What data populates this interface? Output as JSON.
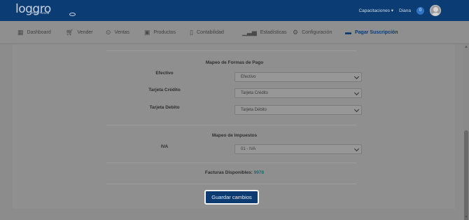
{
  "header": {
    "logo_text": "loggro",
    "logo_sub": "POS Tienda",
    "capacitaciones": "Capacitaciones",
    "user_name": "Diana",
    "badge": "0"
  },
  "nav": {
    "items": [
      {
        "label": "Dashboard",
        "icon": "dashboard-icon"
      },
      {
        "label": "Vender",
        "icon": "cart-icon"
      },
      {
        "label": "Ventas",
        "icon": "money-icon"
      },
      {
        "label": "Productos",
        "icon": "box-icon"
      },
      {
        "label": "Contabilidad",
        "icon": "book-icon"
      },
      {
        "label": "Estadísticas",
        "icon": "bar-chart-icon"
      },
      {
        "label": "Configuración",
        "icon": "gear-icon"
      },
      {
        "label": "Pagar Suscripción",
        "icon": "credit-card-icon",
        "active": true
      }
    ]
  },
  "payment_mapping": {
    "title": "Mapeo de Formas de Pago",
    "rows": [
      {
        "label": "Efectivo",
        "value": "Efectivo"
      },
      {
        "label": "Tarjeta Crédito",
        "value": "Tarjeta Crédito"
      },
      {
        "label": "Tarjeta Debito",
        "value": "Tarjeta Débito"
      }
    ]
  },
  "tax_mapping": {
    "title": "Mapeo de Impuestos",
    "rows": [
      {
        "label": "IVA",
        "value": "01 - IVA"
      }
    ]
  },
  "invoices": {
    "label": "Facturas Disponibles:",
    "count": "9978"
  },
  "save_button": "Guardar cambios",
  "colors": {
    "header_bg": "#0b3c73",
    "active_nav": "#0c3a6f",
    "button_bg": "#0c3b72",
    "count_color": "#1d6b6b"
  }
}
